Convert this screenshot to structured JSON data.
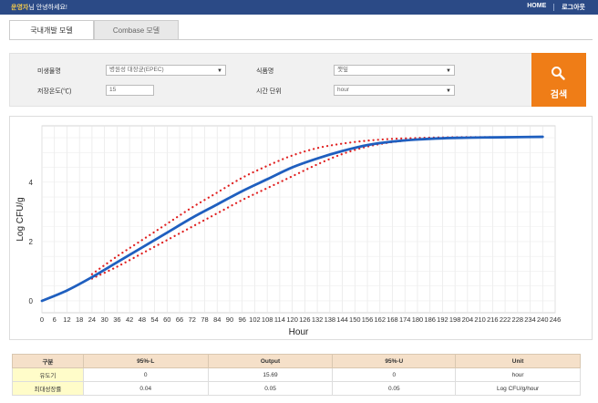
{
  "header": {
    "user_name": "운영자",
    "greeting": "님 안녕하세요!",
    "home_link": "HOME",
    "logout_link": "로그아웃"
  },
  "tabs": [
    {
      "label": "국내개발 모델",
      "active": true
    },
    {
      "label": "Combase 모델",
      "active": false
    }
  ],
  "filters": {
    "microbe_label": "미생물명",
    "microbe_value": "병원성 대장균(EPEC)",
    "food_label": "식품명",
    "food_value": "깻잎",
    "temp_label": "저장온도(℃)",
    "temp_value": "15",
    "time_unit_label": "시간 단위",
    "time_unit_value": "hour",
    "search_label": "검색",
    "search_icon": "search-icon"
  },
  "chart_data": {
    "type": "line",
    "xlabel": "Hour",
    "ylabel": "Log CFU/g",
    "xlim": [
      0,
      246
    ],
    "ylim": [
      -0.4,
      5.9
    ],
    "x_ticks": [
      0,
      6,
      12,
      18,
      24,
      30,
      36,
      42,
      48,
      54,
      60,
      66,
      72,
      78,
      84,
      90,
      96,
      102,
      108,
      114,
      120,
      126,
      132,
      138,
      144,
      150,
      156,
      162,
      168,
      174,
      180,
      186,
      192,
      198,
      204,
      210,
      216,
      222,
      228,
      234,
      240,
      246
    ],
    "y_ticks": [
      0,
      2,
      4
    ],
    "grid": true,
    "series": [
      {
        "style": "solid",
        "color": "#1f5fbf",
        "x": [
          0,
          12,
          24,
          36,
          48,
          60,
          72,
          84,
          96,
          108,
          120,
          132,
          144,
          156,
          168,
          180,
          192,
          204,
          216,
          228,
          240
        ],
        "y": [
          0,
          0.35,
          0.8,
          1.3,
          1.8,
          2.3,
          2.8,
          3.25,
          3.7,
          4.1,
          4.5,
          4.8,
          5.05,
          5.25,
          5.37,
          5.44,
          5.48,
          5.5,
          5.51,
          5.52,
          5.53
        ]
      },
      {
        "style": "dotted",
        "color": "#e02020",
        "x": [
          24,
          36,
          48,
          60,
          72,
          84,
          96,
          108,
          120,
          132,
          144,
          156,
          168,
          180,
          192,
          204,
          216
        ],
        "y": [
          0.9,
          1.5,
          2.05,
          2.6,
          3.15,
          3.65,
          4.15,
          4.55,
          4.9,
          5.15,
          5.3,
          5.4,
          5.46,
          5.49,
          5.51,
          5.52,
          5.52
        ]
      },
      {
        "style": "dotted",
        "color": "#e02020",
        "x": [
          24,
          36,
          48,
          60,
          72,
          84,
          96,
          108,
          120,
          132,
          144,
          156,
          168,
          180,
          192,
          204,
          216
        ],
        "y": [
          0.75,
          1.15,
          1.6,
          2.05,
          2.5,
          2.95,
          3.4,
          3.8,
          4.2,
          4.6,
          4.95,
          5.2,
          5.35,
          5.44,
          5.48,
          5.5,
          5.51
        ]
      }
    ]
  },
  "table": {
    "headers": [
      "구분",
      "95%-L",
      "Output",
      "95%-U",
      "Unit"
    ],
    "rows": [
      [
        "유도기",
        "0",
        "15.69",
        "0",
        "hour"
      ],
      [
        "최대성장률",
        "0.04",
        "0.05",
        "0.05",
        "Log CFU/g/hour"
      ]
    ]
  },
  "colors": {
    "topbar": "#2b4a86",
    "search_button": "#ef7d17",
    "table_header": "#f5e0c9",
    "table_rowhead": "#fffcc9",
    "growth_curve": "#1f5fbf",
    "confidence_bounds": "#e02020"
  }
}
